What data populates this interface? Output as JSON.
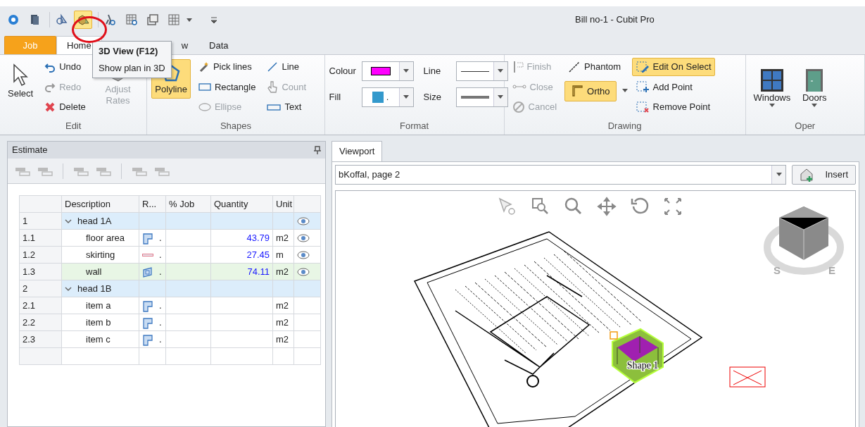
{
  "quick_access": {
    "buttons": [
      {
        "hovered": false
      },
      {
        "hovered": false
      },
      {
        "hovered": false
      },
      {
        "hovered": true
      },
      {
        "hovered": false
      },
      {
        "hovered": false
      },
      {
        "hovered": false
      },
      {
        "hovered": false
      }
    ],
    "title": "Bill no-1 - Cubit Pro"
  },
  "tabs": [
    {
      "label": "Job",
      "kind": "app",
      "selected": false
    },
    {
      "label": "Home",
      "kind": "tab",
      "selected": true
    },
    {
      "label": "w",
      "kind": "tab",
      "selected": false
    },
    {
      "label": "Data",
      "kind": "tab",
      "selected": false
    }
  ],
  "tooltip": {
    "title": "3D View (F12)",
    "text": "Show plan in 3D"
  },
  "ribbon_groups": [
    {
      "label": "Edit",
      "columns": [
        [
          {
            "kind": "large",
            "label": "Select",
            "active": false,
            "disabled": false
          }
        ],
        [
          {
            "kind": "small",
            "label": "Undo",
            "active": false,
            "disabled": false
          },
          {
            "kind": "small",
            "label": "Redo",
            "active": false,
            "disabled": true
          },
          {
            "kind": "small",
            "label": "Delete",
            "active": false,
            "disabled": false
          }
        ],
        [
          {
            "kind": "large",
            "label": "Adjust Rates",
            "active": false,
            "disabled": true
          }
        ]
      ]
    },
    {
      "label": "Shapes",
      "columns": [
        [
          {
            "kind": "large",
            "label": "Polyline",
            "active": true,
            "disabled": false
          }
        ],
        [
          {
            "kind": "small",
            "label": "Pick lines",
            "active": false,
            "disabled": false
          },
          {
            "kind": "small",
            "label": "Rectangle",
            "active": false,
            "disabled": false
          },
          {
            "kind": "small",
            "label": "Ellipse",
            "active": false,
            "disabled": true
          }
        ],
        [
          {
            "kind": "small",
            "label": "Line",
            "active": false,
            "disabled": false
          },
          {
            "kind": "small",
            "label": "Count",
            "active": false,
            "disabled": true
          },
          {
            "kind": "small",
            "label": "Text",
            "active": false,
            "disabled": false
          }
        ]
      ]
    },
    {
      "label": "Format",
      "columns": [
        [
          {
            "kind": "swatch",
            "label": "Colour",
            "color": "#ff00ff"
          },
          {
            "kind": "swatch",
            "label": "Fill",
            "color": "#3399cc",
            "text": "."
          }
        ],
        [
          {
            "kind": "thinline",
            "label": "Line"
          },
          {
            "kind": "thickline",
            "label": "Size"
          }
        ]
      ]
    },
    {
      "label": "Drawing",
      "columns": [
        [
          {
            "kind": "small",
            "label": "Finish",
            "active": false,
            "disabled": true
          },
          {
            "kind": "small",
            "label": "Close",
            "active": false,
            "disabled": true
          },
          {
            "kind": "small",
            "label": "Cancel",
            "active": false,
            "disabled": true
          }
        ],
        [
          {
            "kind": "small",
            "label": "Phantom",
            "active": false,
            "disabled": false
          },
          {
            "kind": "split",
            "label": "Ortho",
            "active": true,
            "disabled": false
          }
        ],
        [
          {
            "kind": "small",
            "label": "Edit On Select",
            "active": true,
            "disabled": false
          },
          {
            "kind": "small",
            "label": "Add Point",
            "active": false,
            "disabled": false
          },
          {
            "kind": "small",
            "label": "Remove Point",
            "active": false,
            "disabled": false
          }
        ]
      ]
    },
    {
      "label": "Oper",
      "columns": [
        [
          {
            "kind": "menu",
            "label": "Windows",
            "active": false,
            "disabled": false
          }
        ],
        [
          {
            "kind": "menu",
            "label": "Doors",
            "active": false,
            "disabled": false
          }
        ]
      ]
    }
  ],
  "estimate": {
    "title": "Estimate",
    "columns": [
      "Description",
      "R...",
      "% Job",
      "Quantity",
      "Unit"
    ],
    "rows": [
      {
        "number": "1",
        "description": "head 1A",
        "expanded": true,
        "visible": true,
        "selected": false,
        "children": [
          {
            "number": "1.1",
            "description": "floor area",
            "kind": "area",
            "rate": ".",
            "quantity": "43.79",
            "unit": "m2",
            "visible": true,
            "selected": false
          },
          {
            "number": "1.2",
            "description": "skirting",
            "kind": "line",
            "rate": ".",
            "quantity": "27.45",
            "unit": "m",
            "visible": true,
            "selected": false
          },
          {
            "number": "1.3",
            "description": "wall",
            "kind": "wall",
            "rate": ".",
            "quantity": "74.11",
            "unit": "m2",
            "visible": true,
            "selected": true
          }
        ]
      },
      {
        "number": "2",
        "description": "head 1B",
        "expanded": true,
        "visible": false,
        "selected": false,
        "children": [
          {
            "number": "2.1",
            "description": "item a",
            "kind": "area",
            "rate": ".",
            "unit": "m2",
            "visible": false,
            "selected": false
          },
          {
            "number": "2.2",
            "description": "item b",
            "kind": "area",
            "rate": ".",
            "unit": "m2",
            "visible": false,
            "selected": false
          },
          {
            "number": "2.3",
            "description": "item c",
            "kind": "area",
            "rate": ".",
            "unit": "m2",
            "visible": false,
            "selected": false
          }
        ]
      }
    ]
  },
  "viewport": {
    "tab": {
      "label": "Viewport",
      "selected": true
    },
    "page_select": {
      "value": "bKoffal, page 2"
    },
    "insert_button": "Insert",
    "shape_label": "Shape 1",
    "compass": [
      "S",
      "E"
    ]
  }
}
